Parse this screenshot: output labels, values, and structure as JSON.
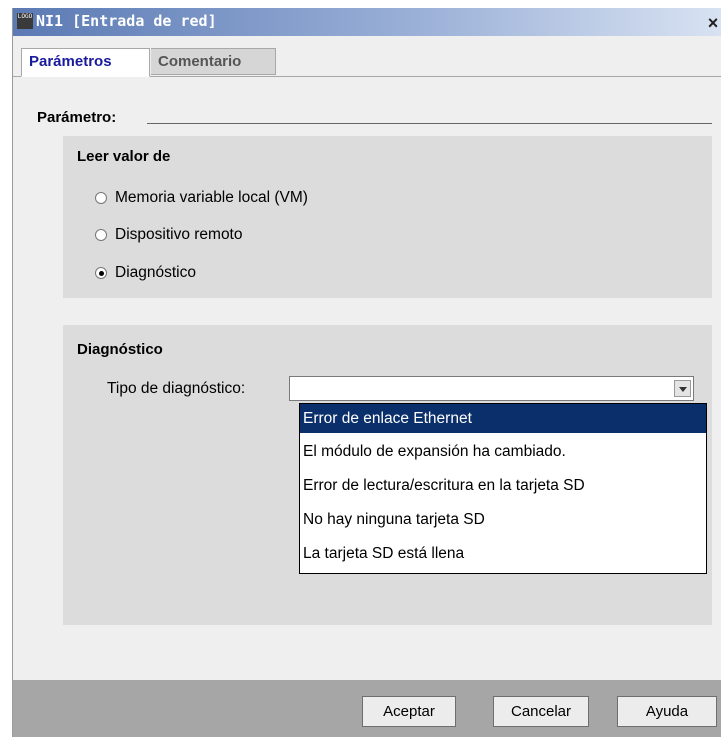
{
  "window": {
    "icon_text": "LOGO",
    "title": "NI1 [Entrada de red]",
    "close_glyph": "×"
  },
  "tabs": [
    {
      "label": "Parámetros",
      "active": true
    },
    {
      "label": "Comentario",
      "active": false
    }
  ],
  "section": {
    "label": "Parámetro:"
  },
  "read_from": {
    "title": "Leer valor de",
    "options": [
      {
        "label": "Memoria variable local (VM)",
        "checked": false
      },
      {
        "label": "Dispositivo remoto",
        "checked": false
      },
      {
        "label": "Diagnóstico",
        "checked": true
      }
    ]
  },
  "diagnostic": {
    "title": "Diagnóstico",
    "type_label": "Tipo de diagnóstico:",
    "selected_value": "",
    "options": [
      {
        "label": "Error de enlace Ethernet",
        "highlighted": true
      },
      {
        "label": "El módulo de expansión ha cambiado.",
        "highlighted": false
      },
      {
        "label": "Error de lectura/escritura en la tarjeta SD",
        "highlighted": false
      },
      {
        "label": "No hay ninguna tarjeta SD",
        "highlighted": false
      },
      {
        "label": "La tarjeta SD está llena",
        "highlighted": false
      }
    ]
  },
  "buttons": {
    "ok": "Aceptar",
    "cancel": "Cancelar",
    "help": "Ayuda"
  },
  "colors": {
    "title_gradient_start": "#5b7ab4",
    "active_tab_text": "#1a1a9c",
    "highlight": "#0a2f6b"
  }
}
